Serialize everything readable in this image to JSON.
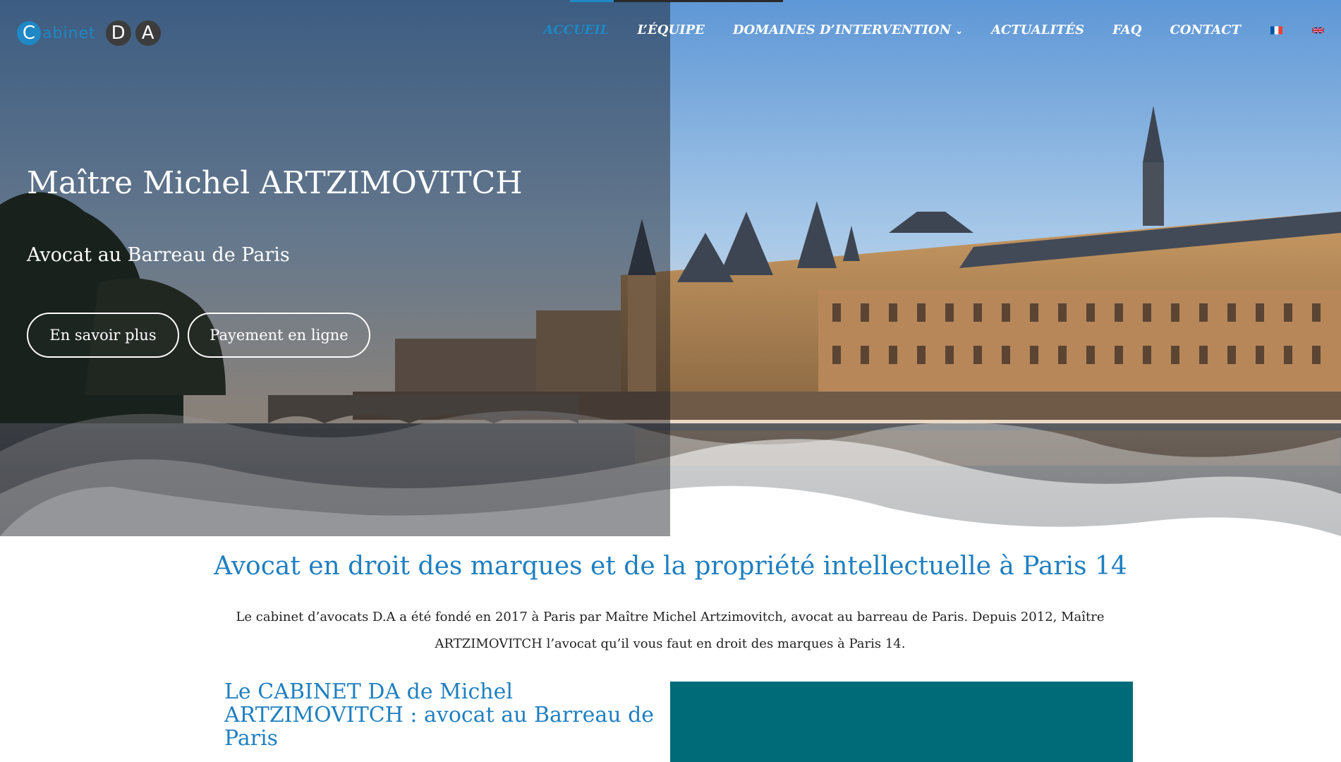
{
  "logo": {
    "letter_c": "C",
    "word": "abinet",
    "letter_d": "D",
    "letter_a": "A"
  },
  "nav": {
    "items": [
      {
        "label": "ACCUEIL",
        "active": true
      },
      {
        "label": "L’ÉQUIPE",
        "active": false
      },
      {
        "label": "DOMAINES D’INTERVENTION",
        "active": false,
        "has_dropdown": true
      },
      {
        "label": "ACTUALITÉS",
        "active": false
      },
      {
        "label": "FAQ",
        "active": false
      },
      {
        "label": "CONTACT",
        "active": false
      }
    ],
    "languages": [
      "fr-flag-icon",
      "gb-flag-icon"
    ]
  },
  "hero": {
    "title": "Maître Michel ARTZIMOVITCH",
    "subtitle": "Avocat au Barreau de Paris",
    "buttons": {
      "primary": "En savoir plus",
      "secondary": "Payement en ligne"
    }
  },
  "main": {
    "heading": "Avocat en droit des marques et de la propriété intellectuelle à Paris 14",
    "intro": "Le cabinet d’avocats D.A a été fondé en 2017 à Paris par Maître Michel Artzimovitch, avocat au barreau de Paris. Depuis 2012, Maître ARTZIMOVITCH l’avocat qu’il vous faut en droit des marques à Paris 14.",
    "section_heading": "Le CABINET DA de Michel ARTZIMOVITCH : avocat au Barreau de Paris"
  },
  "colors": {
    "accent": "#1f88c5",
    "heading_blue": "#1f7fc0",
    "teal": "#006b78"
  }
}
